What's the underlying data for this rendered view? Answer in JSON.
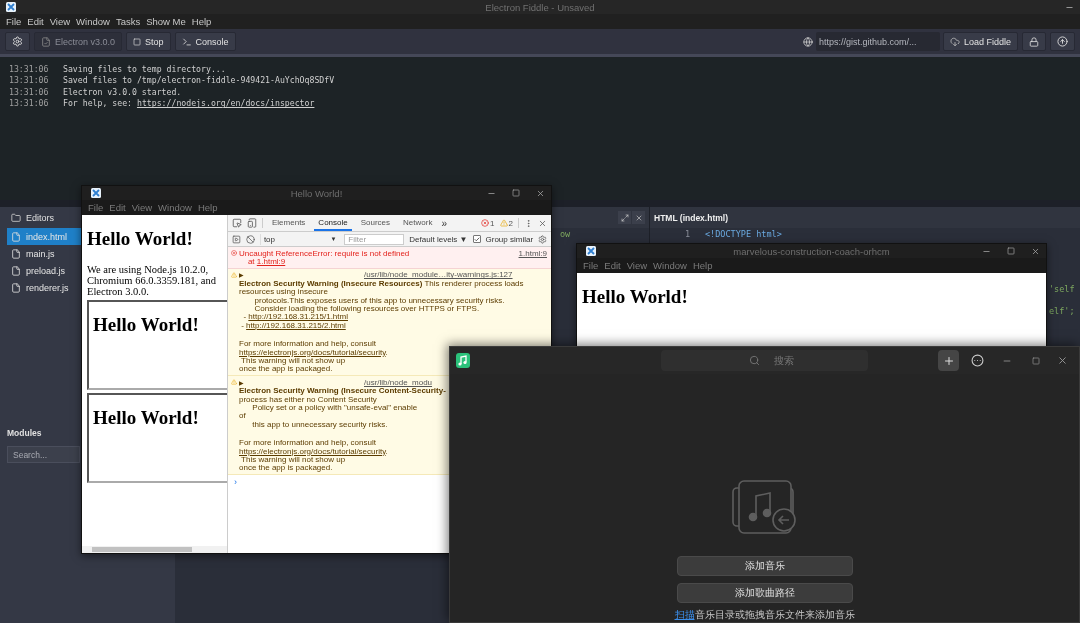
{
  "fiddle": {
    "title": "Electron Fiddle - Unsaved",
    "menu": [
      "File",
      "Edit",
      "View",
      "Window",
      "Tasks",
      "Show Me",
      "Help"
    ],
    "toolbar": {
      "version": "Electron v3.0.0",
      "stop": "Stop",
      "console": "Console",
      "gist_placeholder": "https://gist.github.com/...",
      "load": "Load Fiddle"
    },
    "console": [
      {
        "time": "13:31:06",
        "text": "Saving files to temp directory..."
      },
      {
        "time": "13:31:06",
        "text": "Saved files to /tmp/electron-fiddle-949421-AuYchOq8SDfV"
      },
      {
        "time": "13:31:06",
        "text": "Electron v3.0.0 started."
      },
      {
        "time": "13:31:06",
        "text": "For help, see: ",
        "link": "https://nodejs.org/en/docs/inspector"
      }
    ],
    "sidebar": {
      "heading": "Editors",
      "files": [
        {
          "name": "index.html",
          "selected": true
        },
        {
          "name": "main.js",
          "selected": false
        },
        {
          "name": "preload.js",
          "selected": false
        },
        {
          "name": "renderer.js",
          "selected": false
        }
      ],
      "modules_heading": "Modules",
      "search_placeholder": "Search..."
    },
    "editors": {
      "left": {
        "fragment": "ow"
      },
      "right": {
        "title": "HTML (index.html)",
        "lines": [
          {
            "number": "1",
            "code": "<!DOCTYPE html>"
          }
        ],
        "fragments": [
          "'self",
          "elf';"
        ]
      }
    }
  },
  "hello_window": {
    "title": "Hello World!",
    "menu": [
      "File",
      "Edit",
      "View",
      "Window",
      "Help"
    ],
    "page": {
      "heading": "Hello World!",
      "paragraph": "We are using Node.js 10.2.0, Chromium 66.0.3359.181, and Electron 3.0.0.",
      "frames": [
        "Hello World!",
        "Hello World!"
      ]
    },
    "devtools": {
      "tabs": [
        {
          "label": "Elements",
          "selected": false
        },
        {
          "label": "Console",
          "selected": true
        },
        {
          "label": "Sources",
          "selected": false
        },
        {
          "label": "Network",
          "selected": false
        }
      ],
      "more": "»",
      "error_count": "1",
      "warning_count": "2",
      "context": "top",
      "context_arrow": "▼",
      "filter_placeholder": "Filter",
      "levels": "Default levels ▼",
      "group_similar": {
        "label": "Group similar",
        "checked": true
      },
      "messages": [
        {
          "kind": "error",
          "source": "1.html:9",
          "lines": [
            {
              "text": "Uncaught ReferenceError: require is not defined"
            },
            {
              "text": "    at ",
              "link": "1.html:9"
            }
          ]
        },
        {
          "kind": "warning",
          "expander": "▶",
          "source": "/usr/lib/node_module…ity-warnings.js:127",
          "lines": [
            {
              "text": "**Electron Security Warning (Insecure Resources)** This renderer process loads"
            },
            {
              "text": "resources using insecure"
            },
            {
              "text": "       protocols.This exposes users of this app to unnecessary security risks."
            },
            {
              "text": "       Consider loading the following resources over HTTPS or FTPS."
            },
            {
              "text": "  - ",
              "link": "http://192.168.31.215/1.html"
            },
            {
              "text": " - ",
              "link": "http://192.168.31.215/2.html"
            },
            {
              "text": "For more information and help, consult",
              "space_before": true
            },
            {
              "link": "https://electronjs.org/docs/tutorial/security",
              "after": "."
            },
            {
              "text": " This warning will not show up"
            },
            {
              "text": "once the app is packaged."
            }
          ]
        },
        {
          "kind": "warning",
          "expander": "▶",
          "source": "/usr/lib/node_modu",
          "lines": [
            {
              "text": "Electron Security Warning (Insecure Content-Security-",
              "bold": true
            },
            {
              "text": "process has either no Content Security"
            },
            {
              "text": "      Policy set or a policy with \"unsafe-eval\" enable"
            },
            {
              "text": "of"
            },
            {
              "text": "      this app to unnecessary security risks."
            },
            {
              "text": "For more information and help, consult",
              "space_before": true
            },
            {
              "link": "https://electronjs.org/docs/tutorial/security",
              "after": "."
            },
            {
              "text": " This warning will not show up"
            },
            {
              "text": "once the app is packaged."
            }
          ]
        }
      ],
      "prompt": "›"
    }
  },
  "second_window": {
    "title": "marvelous-construction-coach-orhcm",
    "menu": [
      "File",
      "Edit",
      "View",
      "Window",
      "Help"
    ],
    "heading": "Hello World!"
  },
  "music_window": {
    "search_placeholder": "搜索",
    "buttons": [
      "添加音乐",
      "添加歌曲路径"
    ],
    "hint_link": "扫描",
    "hint": "音乐目录或拖拽音乐文件来添加音乐"
  }
}
